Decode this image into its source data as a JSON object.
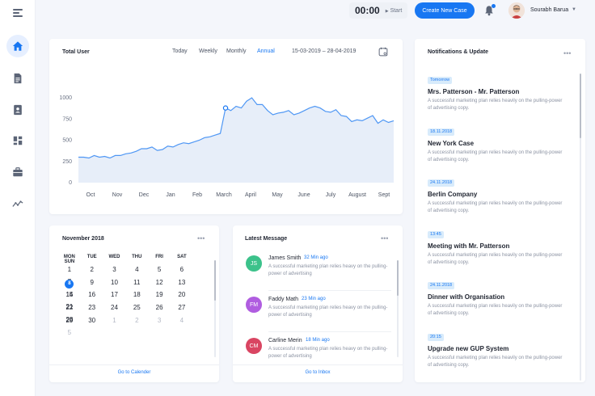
{
  "colors": {
    "accent": "#1877f2",
    "chart_fill": "#e7eef9",
    "chart_line": "#1877f2"
  },
  "sidebar": {
    "items": [
      {
        "icon": "home-icon",
        "active": true
      },
      {
        "icon": "document-icon"
      },
      {
        "icon": "contacts-icon"
      },
      {
        "icon": "dashboard-icon"
      },
      {
        "icon": "briefcase-icon"
      },
      {
        "icon": "trend-icon"
      }
    ]
  },
  "header": {
    "timer": "00:00",
    "start_label": "Start",
    "create_button": "Create New Case",
    "user_name": "Sourabh Barua"
  },
  "total_user": {
    "title": "Total User",
    "tabs": [
      "Today",
      "Weekly",
      "Monthly",
      "Annual"
    ],
    "active_tab": "Annual",
    "date_range": "15-03-2019  –  28-04-2019"
  },
  "chart_data": {
    "type": "area",
    "categories": [
      "Oct",
      "Nov",
      "Dec",
      "Jan",
      "Feb",
      "March",
      "April",
      "May",
      "June",
      "July",
      "August",
      "Sept"
    ],
    "ylim": [
      0,
      1000
    ],
    "yticks": [
      "1000",
      "750",
      "500",
      "250",
      "0"
    ],
    "highlight_index": 28,
    "values": [
      300,
      300,
      290,
      320,
      300,
      310,
      290,
      320,
      320,
      340,
      350,
      370,
      400,
      400,
      420,
      380,
      390,
      430,
      420,
      450,
      470,
      460,
      480,
      500,
      530,
      540,
      560,
      580,
      880,
      850,
      900,
      880,
      960,
      1000,
      920,
      920,
      850,
      800,
      820,
      830,
      850,
      800,
      820,
      850,
      880,
      900,
      880,
      840,
      830,
      860,
      790,
      780,
      720,
      740,
      730,
      760,
      790,
      700,
      740,
      710,
      730
    ]
  },
  "calendar": {
    "title": "November 2018",
    "weekdays": [
      "MON",
      "TUE",
      "WED",
      "THU",
      "FRI",
      "SAT",
      "SUN"
    ],
    "weeks": [
      [
        "1",
        "2",
        "3",
        "4",
        "5",
        "6",
        "7"
      ],
      [
        "8",
        "9",
        "10",
        "11",
        "12",
        "13",
        "14"
      ],
      [
        "15",
        "16",
        "17",
        "18",
        "19",
        "20",
        "21"
      ],
      [
        "22",
        "23",
        "24",
        "25",
        "26",
        "27",
        "28"
      ],
      [
        "29",
        "30",
        "1",
        "2",
        "3",
        "4",
        "5"
      ]
    ],
    "today": "8",
    "footer_link": "Go to Calender"
  },
  "messages": {
    "title": "Latest Message",
    "items": [
      {
        "initials": "JS",
        "name": "James Smith",
        "time": "32 Min ago",
        "text": "A successful marketing plan relies heavy on the pulling-power of advertising",
        "color": "#3cc28b"
      },
      {
        "initials": "FM",
        "name": "Faddy Math",
        "time": "23 Min ago",
        "text": "A successful marketing plan relies heavy on the pulling-power of advertising",
        "color": "#b05de0"
      },
      {
        "initials": "CM",
        "name": "Carline Merin",
        "time": "18 Min ago",
        "text": "A successful marketing plan relies heavy on the pulling-power of advertising",
        "color": "#d94562"
      }
    ],
    "footer_link": "Go to Inbox"
  },
  "notifications": {
    "title": "Notifications & Update",
    "items": [
      {
        "badge": "Tomorrow",
        "title": "Mrs. Patterson - Mr. Patterson",
        "text": "A successful marketing plan relies heavily on the pulling-power of advertising copy."
      },
      {
        "badge": "18.11.2018",
        "title": "New York Case",
        "text": "A successful marketing plan relies heavily on the pulling-power of advertising copy."
      },
      {
        "badge": "24.11.2018",
        "title": "Berlin Company",
        "text": "A successful marketing plan relies heavily on the pulling-power of advertising copy."
      },
      {
        "badge": "13:45",
        "title": "Meeting with Mr. Patterson",
        "text": "A successful marketing plan relies heavily on the pulling-power of advertising copy."
      },
      {
        "badge": "24.11.2018",
        "title": "Dinner with Organisation",
        "text": "A successful marketing plan relies heavily on the pulling-power of advertising copy."
      },
      {
        "badge": "20:15",
        "title": "Upgrade new GUP System",
        "text": "A successful marketing plan relies heavily on the pulling-power of advertising copy."
      }
    ]
  }
}
